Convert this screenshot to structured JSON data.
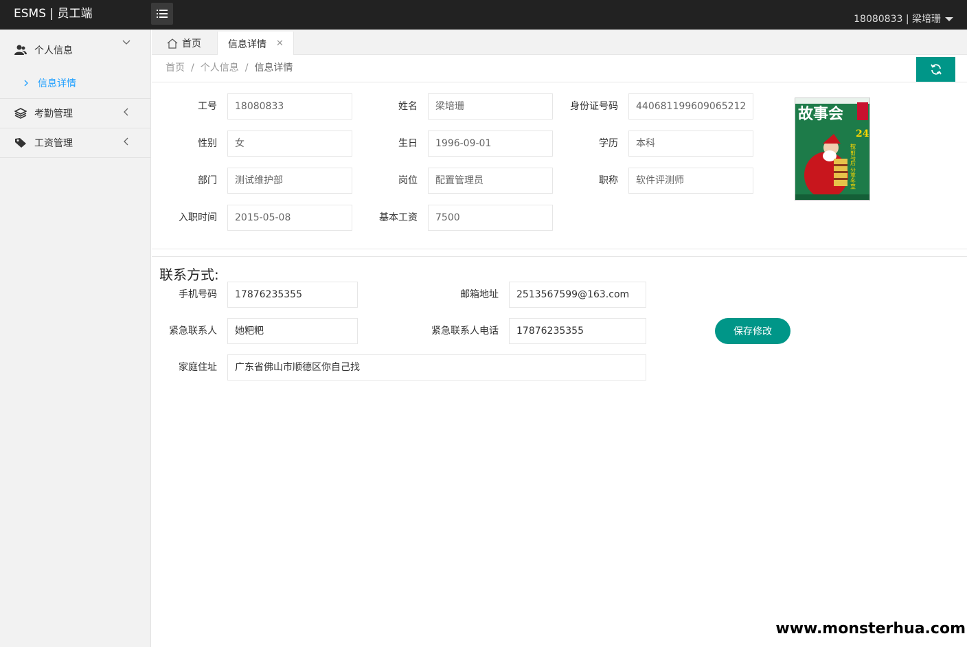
{
  "app": {
    "title": "ESMS | 员工端"
  },
  "user_menu": {
    "label": "18080833 | 梁培珊"
  },
  "sidebar": {
    "groups": [
      {
        "label": "个人信息",
        "icon": "user-icon",
        "children": [
          {
            "label": "信息详情"
          }
        ]
      },
      {
        "label": "考勤管理",
        "icon": "layers-icon"
      },
      {
        "label": "工资管理",
        "icon": "tag-icon"
      }
    ]
  },
  "tabs": [
    {
      "label": "首页",
      "icon": "home-icon"
    },
    {
      "label": "信息详情",
      "active": true
    }
  ],
  "breadcrumb": [
    "首页",
    "个人信息",
    "信息详情"
  ],
  "basic": {
    "emp_id": {
      "label": "工号",
      "value": "18080833"
    },
    "name": {
      "label": "姓名",
      "value": "梁培珊"
    },
    "id_card": {
      "label": "身份证号码",
      "value": "440681199609065212"
    },
    "gender": {
      "label": "性别",
      "value": "女"
    },
    "birthday": {
      "label": "生日",
      "value": "1996-09-01"
    },
    "education": {
      "label": "学历",
      "value": "本科"
    },
    "department": {
      "label": "部门",
      "value": "测试维护部"
    },
    "position": {
      "label": "岗位",
      "value": "配置管理员"
    },
    "title": {
      "label": "职称",
      "value": "软件评测师"
    },
    "hire_date": {
      "label": "入职时间",
      "value": "2015-05-08"
    },
    "base_salary": {
      "label": "基本工资",
      "value": "7500"
    }
  },
  "photo": {
    "masthead": "故事会",
    "issue": "24",
    "side_text": "鞍前马后 分享冬至"
  },
  "contact": {
    "section_title": "联系方式:",
    "phone": {
      "label": "手机号码",
      "value": "17876235355"
    },
    "email": {
      "label": "邮箱地址",
      "value": "2513567599@163.com"
    },
    "emergency_contact": {
      "label": "紧急联系人",
      "value": "她粑粑"
    },
    "emergency_phone": {
      "label": "紧急联系人电话",
      "value": "17876235355"
    },
    "address": {
      "label": "家庭住址",
      "value": "广东省佛山市顺德区你自己找"
    },
    "save_label": "保存修改"
  },
  "watermark": "www.monsterhua.com",
  "colors": {
    "accent": "#009688",
    "link": "#1E9FFF",
    "topbar": "#222222",
    "sidebar": "#f2f2f2"
  }
}
